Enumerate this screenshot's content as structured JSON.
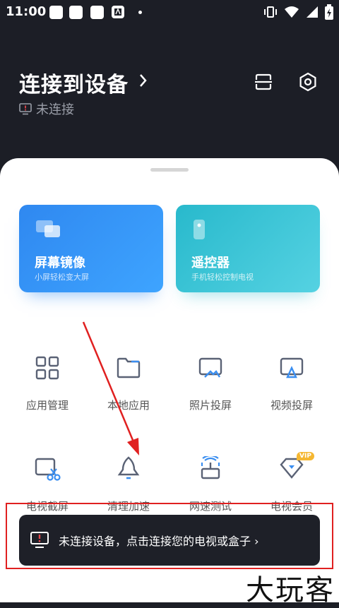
{
  "status_bar": {
    "time": "11:00"
  },
  "header": {
    "title": "连接到设备",
    "status": "未连接"
  },
  "cards": [
    {
      "title": "屏幕镜像",
      "subtitle": "小屏轻松变大屏"
    },
    {
      "title": "遥控器",
      "subtitle": "手机轻松控制电视"
    }
  ],
  "tools": [
    {
      "label": "应用管理"
    },
    {
      "label": "本地应用"
    },
    {
      "label": "照片投屏"
    },
    {
      "label": "视频投屏"
    },
    {
      "label": "电视截屏"
    },
    {
      "label": "清理加速"
    },
    {
      "label": "网速测试"
    },
    {
      "label": "电视会员",
      "badge": "VIP"
    }
  ],
  "toast": {
    "text": "未连接设备，点击连接您的电视或盒子 ›"
  },
  "watermark": "大玩客",
  "colors": {
    "accent": "#3a8ef0",
    "teal": "#2bbccd",
    "annotation": "#e02020",
    "vip": "#f5b731"
  }
}
